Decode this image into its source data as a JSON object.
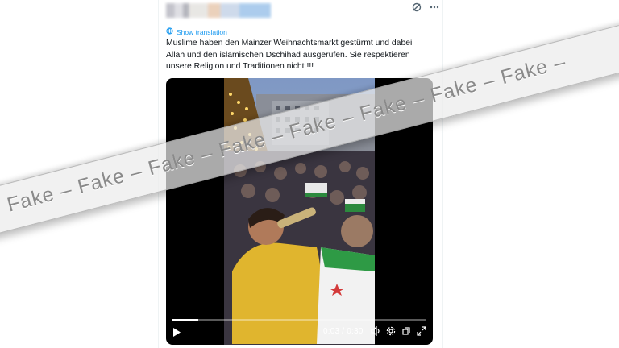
{
  "tweet": {
    "translate_label": "Show translation",
    "text": "Muslime haben den Mainzer Weihnachtsmarkt gestürmt und dabei Allah und den islamischen Dschihad ausgerufen. Sie respektieren unsere Religion und Traditionen nicht !!!",
    "header_icons": [
      "grok-icon",
      "more-icon"
    ]
  },
  "video": {
    "time": "0:03 / 0:30",
    "progress": 0.1,
    "control_icons": [
      "play-icon",
      "volume-icon",
      "settings-icon",
      "picture-in-picture-icon",
      "fullscreen-icon"
    ]
  },
  "watermark": {
    "text": "Fake – Fake – Fake – Fake – Fake – Fake – Fake – Fake –"
  },
  "colors": {
    "link": "#1d9bf0",
    "text": "#0f1419",
    "watermark_band": "#ebebeb"
  }
}
